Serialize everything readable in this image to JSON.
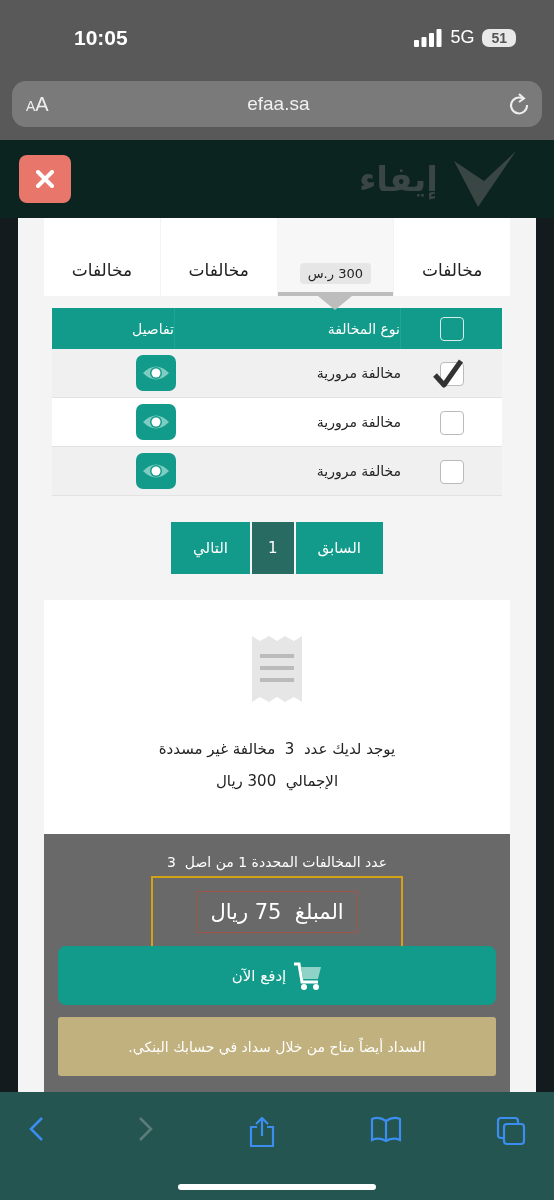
{
  "status_bar": {
    "time": "10:05",
    "network": "5G",
    "battery": "51"
  },
  "browser": {
    "text_size": "AA",
    "url": "efaa.sa"
  },
  "header": {
    "logo": "إيفاء"
  },
  "tabs": [
    {
      "label": "مخالفات",
      "selected": false
    },
    {
      "badge": "300 ر.س",
      "selected": true
    },
    {
      "label": "مخالفات",
      "selected": false
    },
    {
      "label": "مخالفات",
      "selected": false
    }
  ],
  "table": {
    "columns": [
      "نوع المخالفة",
      "تفاصيل"
    ],
    "select_all_checked": false,
    "rows": [
      {
        "type": "مخالفة مرورية",
        "checked": true
      },
      {
        "type": "مخالفة مرورية",
        "checked": false
      },
      {
        "type": "مخالفة مرورية",
        "checked": false
      }
    ]
  },
  "pagination": {
    "previous": "السابق",
    "pages": [
      {
        "label": "1",
        "selected": true
      }
    ],
    "next": "التالي"
  },
  "summary": {
    "line_1": "يوجد لديك عدد  3  مخالفة غير مسددة",
    "line_2": "الإجمالي  300 ريال"
  },
  "payment": {
    "selected_count": "عدد المخالفات المحددة 1 من اصل  3",
    "amount": "المبلغ  75 ريال",
    "pay_button": "إدفع الآن",
    "notice": "السداد أيضاً متاح من خلال سداد في حسابك البنكي."
  }
}
